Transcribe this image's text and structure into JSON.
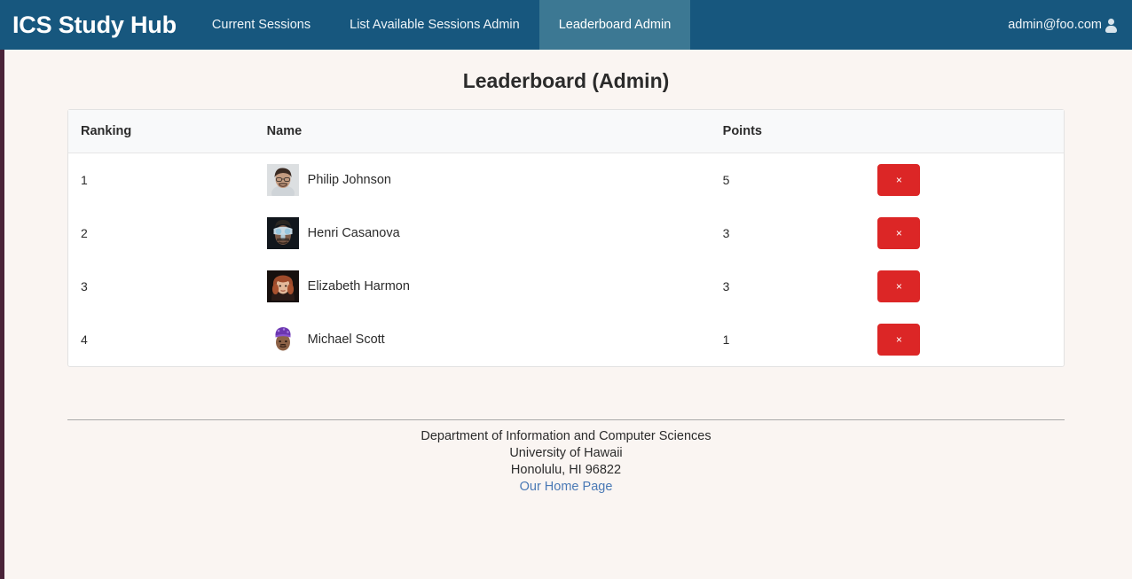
{
  "navbar": {
    "brand": "ICS Study Hub",
    "links": [
      {
        "label": "Current Sessions",
        "active": false
      },
      {
        "label": "List Available Sessions Admin",
        "active": false
      },
      {
        "label": "Leaderboard Admin",
        "active": true
      }
    ],
    "user_email": "admin@foo.com",
    "user_icon": "person-icon",
    "bg_color": "#17577e",
    "active_bg_color": "#3c7893"
  },
  "page": {
    "title": "Leaderboard (Admin)",
    "background_color": "#faf5f2",
    "left_strip_color": "#4a2338"
  },
  "table": {
    "headers": {
      "ranking": "Ranking",
      "name": "Name",
      "points": "Points",
      "actions": ""
    },
    "rows": [
      {
        "ranking": "1",
        "name": "Philip Johnson",
        "points": "5",
        "delete_label": "×",
        "avatar": "philip-johnson-avatar"
      },
      {
        "ranking": "2",
        "name": "Henri Casanova",
        "points": "3",
        "delete_label": "×",
        "avatar": "henri-casanova-avatar"
      },
      {
        "ranking": "3",
        "name": "Elizabeth Harmon",
        "points": "3",
        "delete_label": "×",
        "avatar": "elizabeth-harmon-avatar"
      },
      {
        "ranking": "4",
        "name": "Michael Scott",
        "points": "1",
        "delete_label": "×",
        "avatar": "michael-scott-avatar"
      }
    ],
    "delete_button_color": "#dc2626"
  },
  "footer": {
    "line1": "Department of Information and Computer Sciences",
    "line2": "University of Hawaii",
    "line3": "Honolulu, HI 96822",
    "link": "Our Home Page",
    "link_color": "#4a79b5"
  }
}
